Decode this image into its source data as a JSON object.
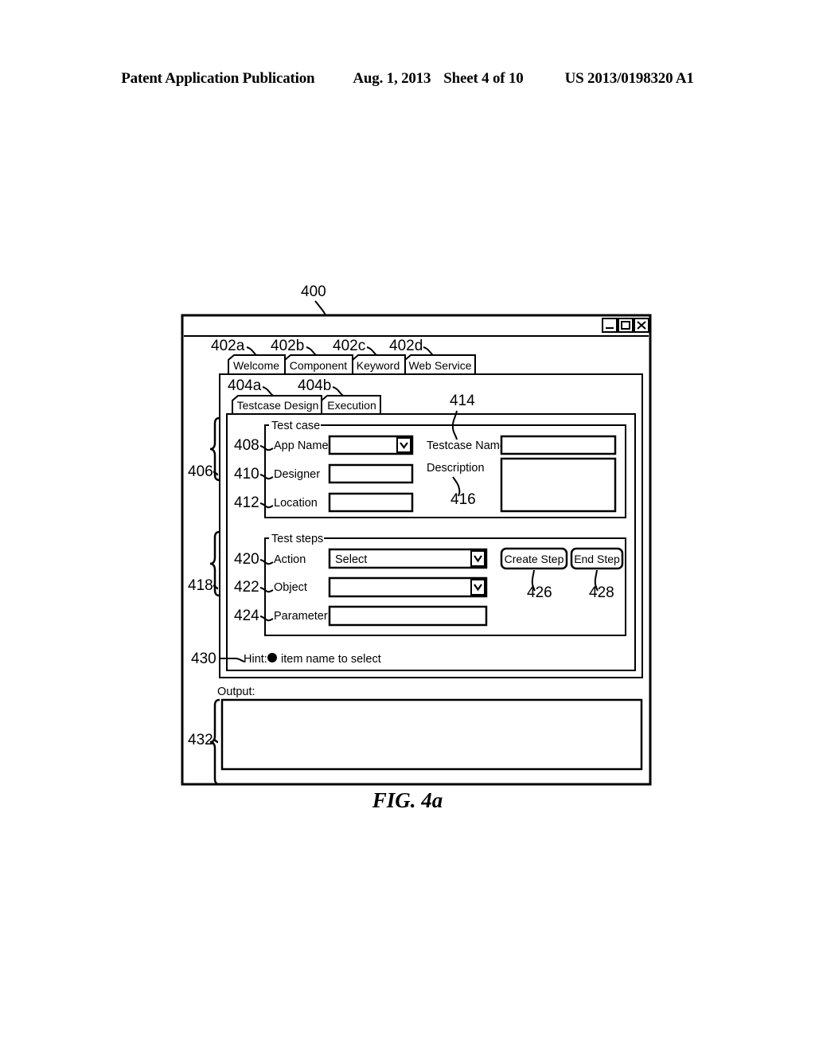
{
  "page_header": {
    "publication": "Patent Application Publication",
    "date": "Aug. 1, 2013",
    "sheet": "Sheet 4 of 10",
    "patent_number": "US 2013/0198320 A1"
  },
  "figure": {
    "caption": "FIG. 4a",
    "window_ref": "400"
  },
  "window": {
    "titlebar": {
      "minimize_glyph": "_",
      "maximize_glyph": "□",
      "close_glyph": "×"
    }
  },
  "main_tabs": {
    "refs": [
      "402a",
      "402b",
      "402c",
      "402d"
    ],
    "items": [
      {
        "label": "Welcome"
      },
      {
        "label": "Component"
      },
      {
        "label": "Keyword"
      },
      {
        "label": "Web Service"
      }
    ],
    "selected": "Keyword"
  },
  "sub_tabs": {
    "refs": [
      "404a",
      "404b"
    ],
    "items": [
      {
        "label": "Testcase Design"
      },
      {
        "label": "Execution"
      }
    ],
    "selected": "Testcase Design"
  },
  "testcase_group": {
    "legend": "Test case",
    "brace_ref": "406",
    "fields": [
      {
        "ref": "408",
        "label": "App Name",
        "value": "",
        "control": "dropdown"
      },
      {
        "ref": "410",
        "label": "Designer",
        "value": "",
        "control": "textbox"
      },
      {
        "ref": "412",
        "label": "Location",
        "value": "",
        "control": "textbox"
      }
    ],
    "right_fields": [
      {
        "ref": "414",
        "label": "Testcase Name",
        "value": "",
        "control": "textbox"
      },
      {
        "ref": "416",
        "label": "Description",
        "value": "",
        "control": "textarea"
      }
    ]
  },
  "teststeps_group": {
    "legend": "Test steps",
    "brace_ref": "418",
    "fields": [
      {
        "ref": "420",
        "label": "Action",
        "value": "Select",
        "control": "dropdown"
      },
      {
        "ref": "422",
        "label": "Object",
        "value": "",
        "control": "dropdown"
      },
      {
        "ref": "424",
        "label": "Parameter",
        "value": "",
        "control": "textbox"
      }
    ],
    "buttons": [
      {
        "ref": "426",
        "label": "Create Step"
      },
      {
        "ref": "428",
        "label": "End Step"
      }
    ]
  },
  "hint": {
    "ref": "430",
    "prefix": "Hint:",
    "bullet": "●",
    "text": "item name to select"
  },
  "output": {
    "ref": "432",
    "label": "Output:",
    "value": ""
  }
}
